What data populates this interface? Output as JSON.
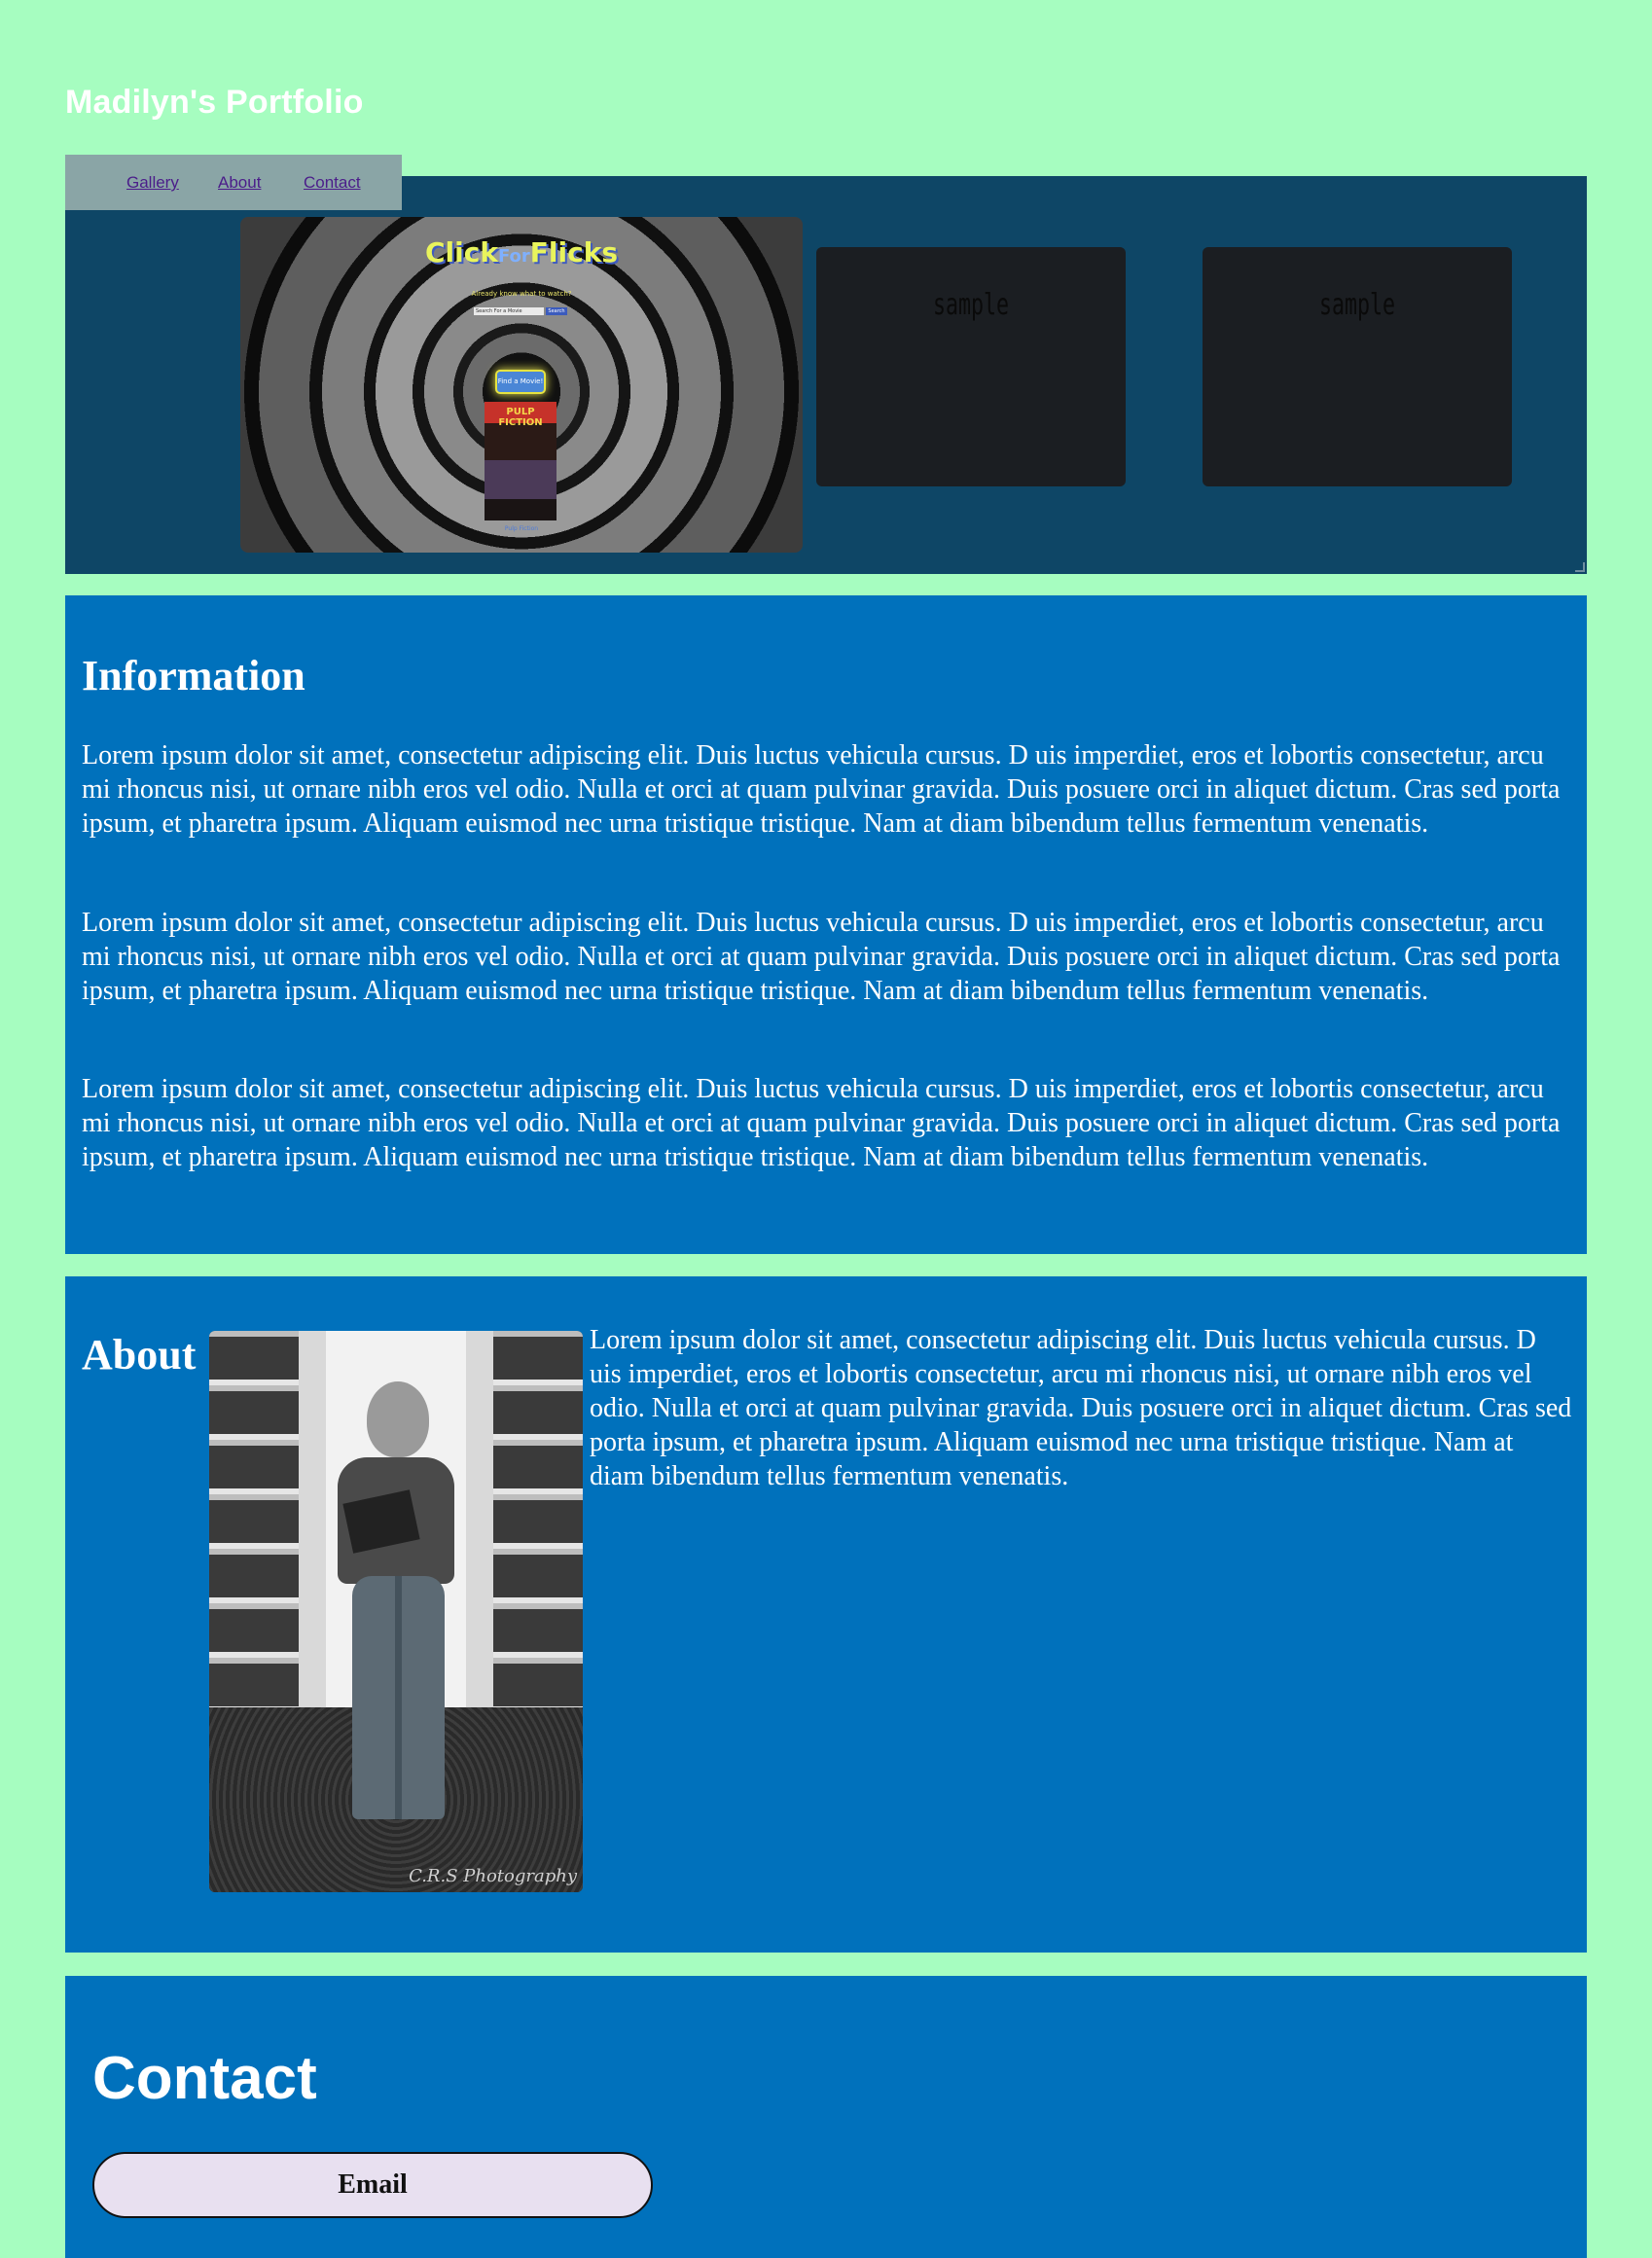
{
  "site": {
    "title": "Madilyn's Portfolio"
  },
  "nav": {
    "items": [
      "Gallery",
      "About",
      "Contact"
    ]
  },
  "gallery": {
    "featured": {
      "logo_click": "Click",
      "logo_for": "For",
      "logo_flicks": "Flicks",
      "tagline": "Already know what to watch?",
      "search_placeholder": "Search For a Movie",
      "search_button": "Search",
      "find_button": "Find a Movie!",
      "poster_title": "PULP FICTION",
      "poster_caption": "Pulp Fiction"
    },
    "samples": [
      "sample",
      "sample"
    ]
  },
  "info": {
    "heading": "Information",
    "paragraphs": [
      "Lorem ipsum dolor sit amet, consectetur adipiscing elit. Duis luctus vehicula cursus. D uis imperdiet, eros et lobortis consectetur, arcu mi rhoncus nisi, ut ornare nibh eros vel odio. Nulla et orci at quam pulvinar gravida. Duis posuere orci in aliquet dictum. Cras sed porta ipsum, et pharetra ipsum. Aliquam euismod nec urna tristique tristique. Nam at diam bibendum tellus fermentum venenatis.",
      "Lorem ipsum dolor sit amet, consectetur adipiscing elit. Duis luctus vehicula cursus. D uis imperdiet, eros et lobortis consectetur, arcu mi rhoncus nisi, ut ornare nibh eros vel odio. Nulla et orci at quam pulvinar gravida. Duis posuere orci in aliquet dictum. Cras sed porta ipsum, et pharetra ipsum. Aliquam euismod nec urna tristique tristique. Nam at diam bibendum tellus fermentum venenatis.",
      "Lorem ipsum dolor sit amet, consectetur adipiscing elit. Duis luctus vehicula cursus. D uis imperdiet, eros et lobortis consectetur, arcu mi rhoncus nisi, ut ornare nibh eros vel odio. Nulla et orci at quam pulvinar gravida. Duis posuere orci in aliquet dictum. Cras sed porta ipsum, et pharetra ipsum. Aliquam euismod nec urna tristique tristique. Nam at diam bibendum tellus fermentum venenatis."
    ]
  },
  "about": {
    "heading": "About",
    "photo_watermark": "C.R.S Photography",
    "text": "Lorem ipsum dolor sit amet, consectetur adipiscing elit. Duis luctus vehicula cursus. D uis imperdiet, eros et lobortis consectetur, arcu mi rhoncus nisi, ut ornare nibh eros vel odio. Nulla et orci at quam pulvinar gravida. Duis posuere orci in aliquet dictum. Cras sed porta ipsum, et pharetra ipsum. Aliquam euismod nec urna tristique tristique. Nam at diam bibendum tellus fermentum venenatis."
  },
  "contact": {
    "heading": "Contact",
    "email_button": "Email"
  },
  "colors": {
    "page_bg": "#a6fdc0",
    "gallery_bg": "#0e4666",
    "section_bg": "#0071bc",
    "nav_bg": "#8aa5a6",
    "link": "#4b1d8a",
    "email_button_bg": "#e8e0f0"
  }
}
